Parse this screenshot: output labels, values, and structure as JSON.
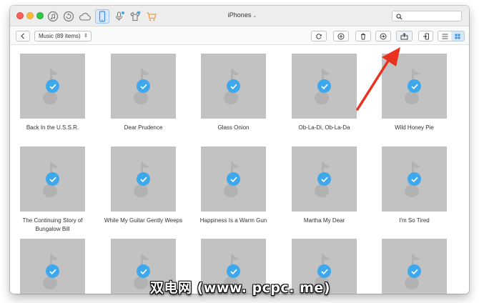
{
  "window": {
    "device_title": "iPhones"
  },
  "top_icons": [
    {
      "name": "itunes-library-icon"
    },
    {
      "name": "backup-restore-icon"
    },
    {
      "name": "icloud-icon"
    },
    {
      "name": "iphone-device-icon",
      "active": true
    },
    {
      "name": "voice-memo-download-icon"
    },
    {
      "name": "shirt-toolkit-icon"
    },
    {
      "name": "shopping-cart-icon"
    }
  ],
  "search": {
    "placeholder": "",
    "value": ""
  },
  "toolbar": {
    "category_select": "Music (89 items)",
    "buttons": [
      "refresh-icon",
      "add-icon",
      "delete-icon",
      "send-to-itunes-icon",
      "send-to-computer-icon",
      "send-to-device-icon"
    ]
  },
  "songs": [
    {
      "title": "Back In the U.S.S.R."
    },
    {
      "title": "Dear Prudence"
    },
    {
      "title": "Glass Onion"
    },
    {
      "title": "Ob-La-Di, Ob-La-Da"
    },
    {
      "title": "Wild Honey Pie"
    },
    {
      "title": "The Continuing Story of Bungalow Bill"
    },
    {
      "title": "While My Guitar Gently Weeps"
    },
    {
      "title": "Happiness Is a Warm Gun"
    },
    {
      "title": "Martha My Dear"
    },
    {
      "title": "I'm So Tired"
    },
    {
      "title": ""
    },
    {
      "title": ""
    },
    {
      "title": ""
    },
    {
      "title": ""
    },
    {
      "title": ""
    }
  ],
  "colors": {
    "accent": "#3ea8ed",
    "thumb": "#c2c2c2",
    "annotation_arrow": "#e8321f"
  },
  "watermark": "双电网 (www. pcpc. me)"
}
